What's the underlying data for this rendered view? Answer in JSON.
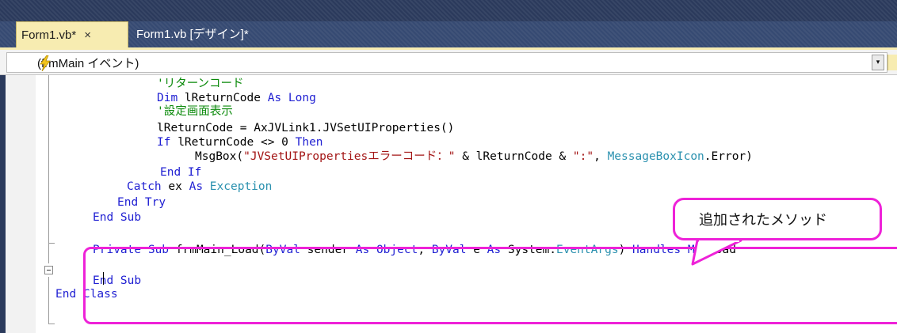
{
  "tabs": {
    "active": {
      "label": "Form1.vb*",
      "close": "×"
    },
    "inactive": {
      "label": "Form1.vb [デザイン]*"
    }
  },
  "member_dropdown": {
    "selected": "(frmMain イベント)",
    "icon": "lightning-event-icon",
    "arrow": "▾"
  },
  "code": {
    "lines": [
      {
        "parts": [
          {
            "t": "'リターンコード",
            "c": "cm"
          }
        ]
      },
      {
        "parts": [
          {
            "t": "Dim ",
            "c": "kw"
          },
          {
            "t": "lReturnCode ",
            "c": ""
          },
          {
            "t": "As Long",
            "c": "kw"
          }
        ]
      },
      {
        "parts": [
          {
            "t": "'設定画面表示",
            "c": "cm"
          }
        ]
      },
      {
        "parts": [
          {
            "t": "lReturnCode = AxJVLink1.JVSetUIProperties()",
            "c": ""
          }
        ]
      },
      {
        "parts": [
          {
            "t": "If ",
            "c": "kw"
          },
          {
            "t": "lReturnCode <> 0 ",
            "c": ""
          },
          {
            "t": "Then",
            "c": "kw"
          }
        ]
      },
      {
        "parts": [
          {
            "t": "MsgBox(",
            "c": ""
          },
          {
            "t": "\"JVSetUIPropertiesエラーコード：\"",
            "c": "st"
          },
          {
            "t": " & lReturnCode & ",
            "c": ""
          },
          {
            "t": "\":\"",
            "c": "st"
          },
          {
            "t": ", ",
            "c": ""
          },
          {
            "t": "MessageBoxIcon",
            "c": "ty"
          },
          {
            "t": ".Error)",
            "c": ""
          }
        ]
      },
      {
        "parts": [
          {
            "t": "End If",
            "c": "kw"
          }
        ]
      },
      {
        "parts": [
          {
            "t": "Catch ",
            "c": "kw"
          },
          {
            "t": "ex ",
            "c": ""
          },
          {
            "t": "As ",
            "c": "kw"
          },
          {
            "t": "Exception",
            "c": "ty"
          }
        ]
      },
      {
        "parts": [
          {
            "t": "End Try",
            "c": "kw"
          }
        ]
      },
      {
        "parts": [
          {
            "t": "End Sub",
            "c": "kw"
          }
        ]
      },
      {
        "parts": [
          {
            "t": "",
            "c": ""
          }
        ]
      },
      {
        "parts": [
          {
            "t": "Private Sub ",
            "c": "kw"
          },
          {
            "t": "frmMain_Load(",
            "c": ""
          },
          {
            "t": "ByVal ",
            "c": "kw"
          },
          {
            "t": "sender ",
            "c": ""
          },
          {
            "t": "As Object",
            "c": "kw"
          },
          {
            "t": ", ",
            "c": ""
          },
          {
            "t": "ByVal ",
            "c": "kw"
          },
          {
            "t": "e ",
            "c": ""
          },
          {
            "t": "As ",
            "c": "kw"
          },
          {
            "t": "System.",
            "c": ""
          },
          {
            "t": "EventArgs",
            "c": "ty"
          },
          {
            "t": ") ",
            "c": ""
          },
          {
            "t": "Handles Me",
            "c": "kw"
          },
          {
            "t": ".Load",
            "c": ""
          }
        ]
      },
      {
        "parts": [
          {
            "t": "",
            "c": ""
          }
        ]
      },
      {
        "parts": [
          {
            "t": "End Sub",
            "c": "kw"
          }
        ]
      },
      {
        "parts": [
          {
            "t": "End Class",
            "c": "kw"
          }
        ]
      }
    ]
  },
  "callout": {
    "text": "追加されたメソッド"
  },
  "colors": {
    "keyword": "#1f1fd2",
    "comment": "#0b8a0b",
    "string": "#a31515",
    "type": "#2b91af",
    "highlight": "#ee22d8",
    "tab_active": "#f7ecb1"
  }
}
